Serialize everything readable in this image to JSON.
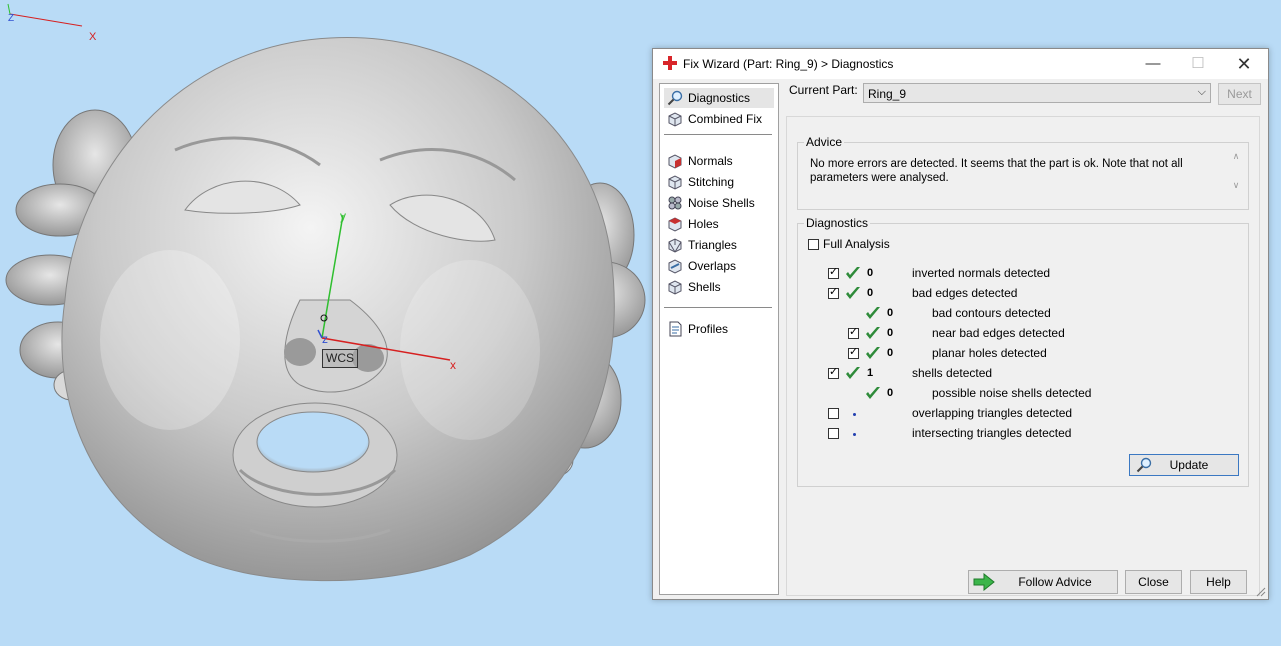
{
  "viewport": {
    "axis_y": "y",
    "axis_x": "x",
    "axis_z": "z",
    "wcs_label": "WCS",
    "corner_axis_x": "X",
    "corner_axis_z": "Z"
  },
  "dialog": {
    "title": "Fix Wizard (Part: Ring_9) > Diagnostics",
    "nav": {
      "items": [
        {
          "label": "Diagnostics",
          "icon": "magnifier-icon"
        },
        {
          "label": "Combined Fix",
          "icon": "cube-icon"
        },
        {
          "label": "Normals",
          "icon": "normals-cube-icon"
        },
        {
          "label": "Stitching",
          "icon": "stitching-icon"
        },
        {
          "label": "Noise Shells",
          "icon": "noise-shells-icon"
        },
        {
          "label": "Holes",
          "icon": "holes-icon"
        },
        {
          "label": "Triangles",
          "icon": "triangles-icon"
        },
        {
          "label": "Overlaps",
          "icon": "overlaps-icon"
        },
        {
          "label": "Shells",
          "icon": "shells-icon"
        },
        {
          "label": "Profiles",
          "icon": "document-icon"
        }
      ]
    },
    "current_part_label": "Current Part:",
    "current_part_value": "Ring_9",
    "next_label": "Next",
    "advice": {
      "title": "Advice",
      "text": "No more errors are detected. It seems that the part is ok. Note that not all parameters were analysed."
    },
    "diagnostics": {
      "title": "Diagnostics",
      "full_analysis_label": "Full Analysis",
      "rows": [
        {
          "checked": true,
          "status": "ok",
          "count": "0",
          "label": "inverted normals detected",
          "indent": 0
        },
        {
          "checked": true,
          "status": "ok",
          "count": "0",
          "label": "bad edges detected",
          "indent": 0
        },
        {
          "checked": null,
          "status": "ok",
          "count": "0",
          "label": "bad contours detected",
          "indent": 1
        },
        {
          "checked": true,
          "status": "ok",
          "count": "0",
          "label": "near bad edges detected",
          "indent": 1
        },
        {
          "checked": true,
          "status": "ok",
          "count": "0",
          "label": "planar holes detected",
          "indent": 1
        },
        {
          "checked": true,
          "status": "ok",
          "count": "1",
          "label": "shells detected",
          "indent": 0
        },
        {
          "checked": null,
          "status": "ok",
          "count": "0",
          "label": "possible noise shells detected",
          "indent": 1
        },
        {
          "checked": false,
          "status": "pending",
          "count": "",
          "label": "overlapping triangles detected",
          "indent": 0
        },
        {
          "checked": false,
          "status": "pending",
          "count": "",
          "label": "intersecting triangles detected",
          "indent": 0
        }
      ],
      "update_label": "Update"
    },
    "buttons": {
      "follow_advice": "Follow Advice",
      "close": "Close",
      "help": "Help"
    },
    "colors": {
      "accent_red": "#d8252a",
      "ok_green": "#2e8b3a",
      "viewport_bg": "#b9dbf6"
    }
  }
}
